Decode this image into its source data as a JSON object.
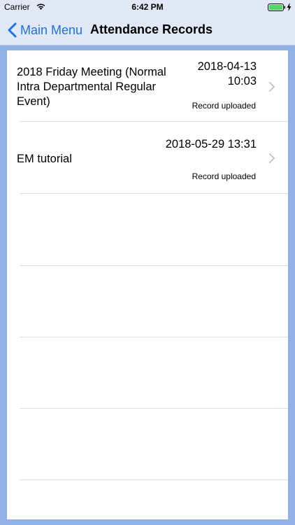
{
  "status_bar": {
    "carrier": "Carrier",
    "time": "6:42 PM"
  },
  "nav": {
    "back_label": "Main Menu",
    "title": "Attendance Records"
  },
  "records": [
    {
      "title": "2018 Friday Meeting (Normal Intra Departmental Regular Event)",
      "date_line1": "2018-04-13",
      "date_line2": "10:03",
      "status": "Record uploaded"
    },
    {
      "title": "EM tutorial",
      "date_line1": "2018-05-29 13:31",
      "status": "Record uploaded"
    }
  ],
  "colors": {
    "accent": "#1d6ff0",
    "nav_background": "#e1e9f7",
    "page_background": "#92b1e5",
    "battery": "#4cd964"
  },
  "icons": [
    "wifi-icon",
    "battery-icon",
    "charging-icon",
    "chevron-left-icon",
    "chevron-right-icon"
  ]
}
